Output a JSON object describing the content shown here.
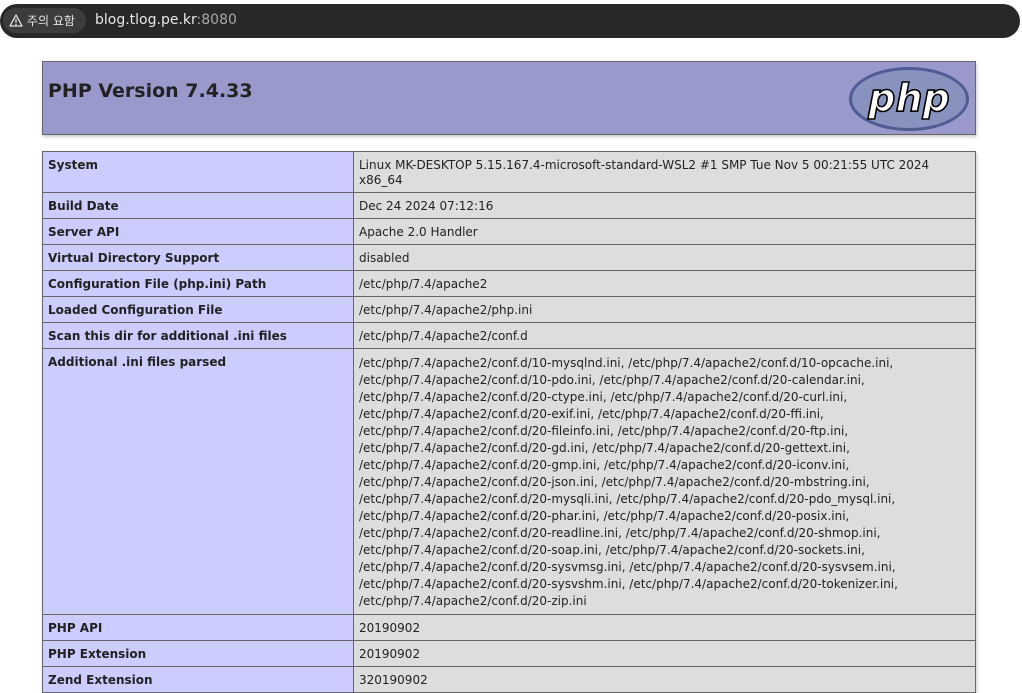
{
  "browser": {
    "warning_label": "주의 요함",
    "url_host": "blog.tlog.pe.kr",
    "url_port": ":8080"
  },
  "header": {
    "title": "PHP Version 7.4.33",
    "logo_text": "php"
  },
  "rows": [
    {
      "key": "System",
      "value": "Linux MK-DESKTOP 5.15.167.4-microsoft-standard-WSL2 #1 SMP Tue Nov 5 00:21:55 UTC 2024 x86_64"
    },
    {
      "key": "Build Date",
      "value": "Dec 24 2024 07:12:16"
    },
    {
      "key": "Server API",
      "value": "Apache 2.0 Handler"
    },
    {
      "key": "Virtual Directory Support",
      "value": "disabled"
    },
    {
      "key": "Configuration File (php.ini) Path",
      "value": "/etc/php/7.4/apache2"
    },
    {
      "key": "Loaded Configuration File",
      "value": "/etc/php/7.4/apache2/php.ini"
    },
    {
      "key": "Scan this dir for additional .ini files",
      "value": "/etc/php/7.4/apache2/conf.d"
    },
    {
      "key": "Additional .ini files parsed",
      "lines": [
        "/etc/php/7.4/apache2/conf.d/10-mysqlnd.ini, /etc/php/7.4/apache2/conf.d/10-opcache.ini,",
        "/etc/php/7.4/apache2/conf.d/10-pdo.ini, /etc/php/7.4/apache2/conf.d/20-calendar.ini,",
        "/etc/php/7.4/apache2/conf.d/20-ctype.ini, /etc/php/7.4/apache2/conf.d/20-curl.ini,",
        "/etc/php/7.4/apache2/conf.d/20-exif.ini, /etc/php/7.4/apache2/conf.d/20-ffi.ini,",
        "/etc/php/7.4/apache2/conf.d/20-fileinfo.ini, /etc/php/7.4/apache2/conf.d/20-ftp.ini,",
        "/etc/php/7.4/apache2/conf.d/20-gd.ini, /etc/php/7.4/apache2/conf.d/20-gettext.ini,",
        "/etc/php/7.4/apache2/conf.d/20-gmp.ini, /etc/php/7.4/apache2/conf.d/20-iconv.ini,",
        "/etc/php/7.4/apache2/conf.d/20-json.ini, /etc/php/7.4/apache2/conf.d/20-mbstring.ini,",
        "/etc/php/7.4/apache2/conf.d/20-mysqli.ini, /etc/php/7.4/apache2/conf.d/20-pdo_mysql.ini,",
        "/etc/php/7.4/apache2/conf.d/20-phar.ini, /etc/php/7.4/apache2/conf.d/20-posix.ini,",
        "/etc/php/7.4/apache2/conf.d/20-readline.ini, /etc/php/7.4/apache2/conf.d/20-shmop.ini,",
        "/etc/php/7.4/apache2/conf.d/20-soap.ini, /etc/php/7.4/apache2/conf.d/20-sockets.ini,",
        "/etc/php/7.4/apache2/conf.d/20-sysvmsg.ini, /etc/php/7.4/apache2/conf.d/20-sysvsem.ini,",
        "/etc/php/7.4/apache2/conf.d/20-sysvshm.ini, /etc/php/7.4/apache2/conf.d/20-tokenizer.ini,",
        "/etc/php/7.4/apache2/conf.d/20-zip.ini"
      ]
    },
    {
      "key": "PHP API",
      "value": "20190902"
    },
    {
      "key": "PHP Extension",
      "value": "20190902"
    },
    {
      "key": "Zend Extension",
      "value": "320190902"
    }
  ],
  "colors": {
    "header_bg": "#9999cc",
    "key_bg": "#ccccff",
    "value_bg": "#dddddd",
    "logo_bg": "#6c7eb7"
  }
}
